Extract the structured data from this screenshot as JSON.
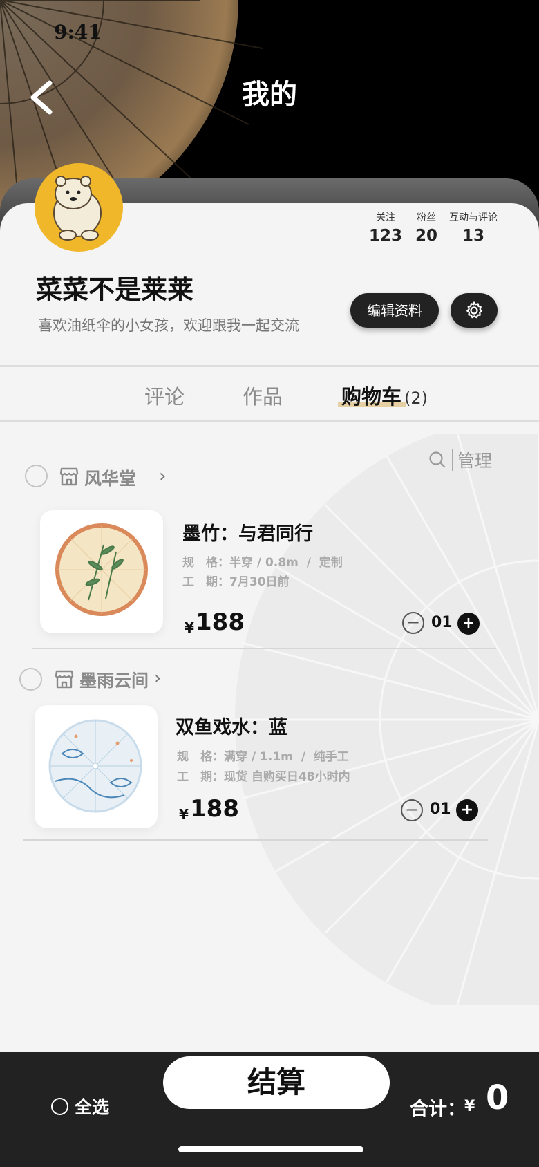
{
  "status_bar": {
    "time": "9:41"
  },
  "nav": {
    "title": "我的",
    "back_icon": "chevron-left-icon"
  },
  "profile": {
    "name": "菜菜不是莱莱",
    "bio": "喜欢油纸伞的小女孩，欢迎跟我一起交流",
    "stats": [
      {
        "label": "关注",
        "value": "123"
      },
      {
        "label": "粉丝",
        "value": "20"
      },
      {
        "label": "互动与评论",
        "value": "13"
      }
    ],
    "edit_label": "编辑资料",
    "settings_icon": "gear-icon"
  },
  "tabs": [
    {
      "label": "评论"
    },
    {
      "label": "作品"
    },
    {
      "label": "购物车",
      "count": "(2)"
    }
  ],
  "cart_tools": {
    "manage_label": "管理",
    "search_icon": "search-icon"
  },
  "shops": [
    {
      "name": "风华堂",
      "item": {
        "title": "墨竹：与君同行",
        "spec": "规　格：半穿 / 0.8m  /  定制",
        "period": "工　期：7月30日前",
        "currency": "¥",
        "price": "188",
        "qty": "01"
      }
    },
    {
      "name": "墨雨云间",
      "item": {
        "title": "双鱼戏水：蓝",
        "spec": "规　格：满穿 / 1.1m  /  纯手工",
        "period": "工　期：现货 自购买日48小时内",
        "currency": "¥",
        "price": "188",
        "qty": "01"
      }
    }
  ],
  "bottom": {
    "select_all": "全选",
    "checkout": "结算",
    "total_label": "合计：",
    "currency": "¥",
    "total": "0"
  },
  "colors": {
    "dark": "#222222",
    "accent_underline": "#e6cfa3",
    "avatar_bg": "#f0b72a"
  }
}
